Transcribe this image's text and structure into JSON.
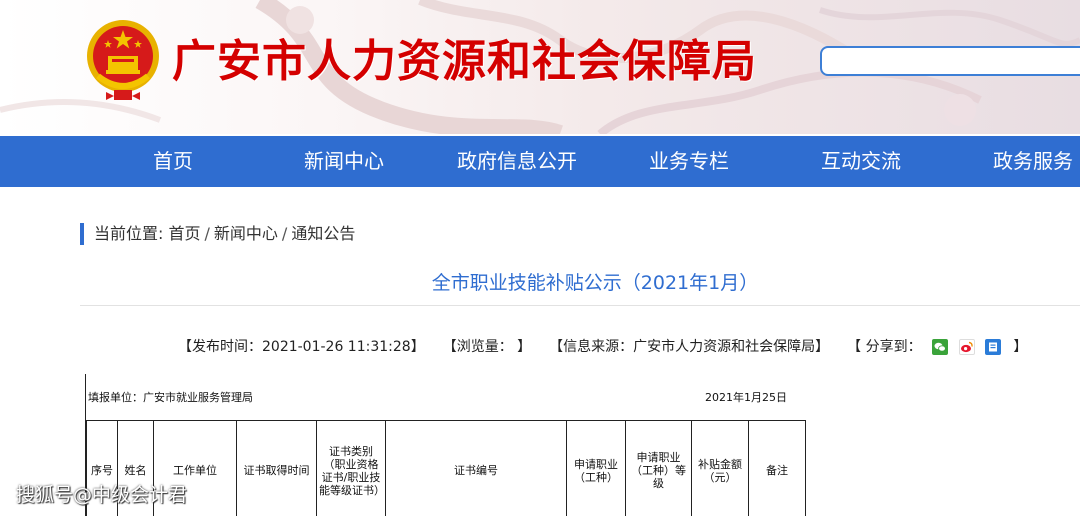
{
  "header": {
    "site_title": "广安市人力资源和社会保障局",
    "search": {
      "value": "",
      "placeholder": ""
    }
  },
  "nav": {
    "items": [
      {
        "label": "首页"
      },
      {
        "label": "新闻中心"
      },
      {
        "label": "政府信息公开"
      },
      {
        "label": "业务专栏"
      },
      {
        "label": "互动交流"
      },
      {
        "label": "政务服务"
      }
    ]
  },
  "breadcrumb": {
    "prefix": "当前位置:",
    "crumbs": [
      "首页",
      "新闻中心",
      "通知公告"
    ],
    "separator": "/"
  },
  "article": {
    "title": "全市职业技能补贴公示（2021年1月）",
    "meta": {
      "publish_time": "【发布时间：2021-01-26 11:31:28】",
      "views": "【浏览量：  】",
      "source": "【信息来源：广安市人力资源和社会保障局】",
      "share_label": "【 分享到：",
      "share_end": "】"
    }
  },
  "document": {
    "fill_unit": "填报单位：广安市就业服务管理局",
    "fill_date": "2021年1月25日",
    "table_headers": [
      "序号",
      "姓名",
      "工作单位",
      "证书取得时间",
      "证书类别（职业资格证书/职业技能等级证书）",
      "证书编号",
      "申请职业（工种）",
      "申请职业（工种）等级",
      "补贴金额（元）",
      "备注"
    ]
  },
  "watermark": "搜狐号@中级会计君",
  "colors": {
    "nav_bg": "#2f6dd0",
    "title_red": "#d40000",
    "link_blue": "#2f6dd0"
  },
  "icons": [
    "national-emblem-icon",
    "wechat-share-icon",
    "weibo-share-icon",
    "qzone-share-icon"
  ]
}
